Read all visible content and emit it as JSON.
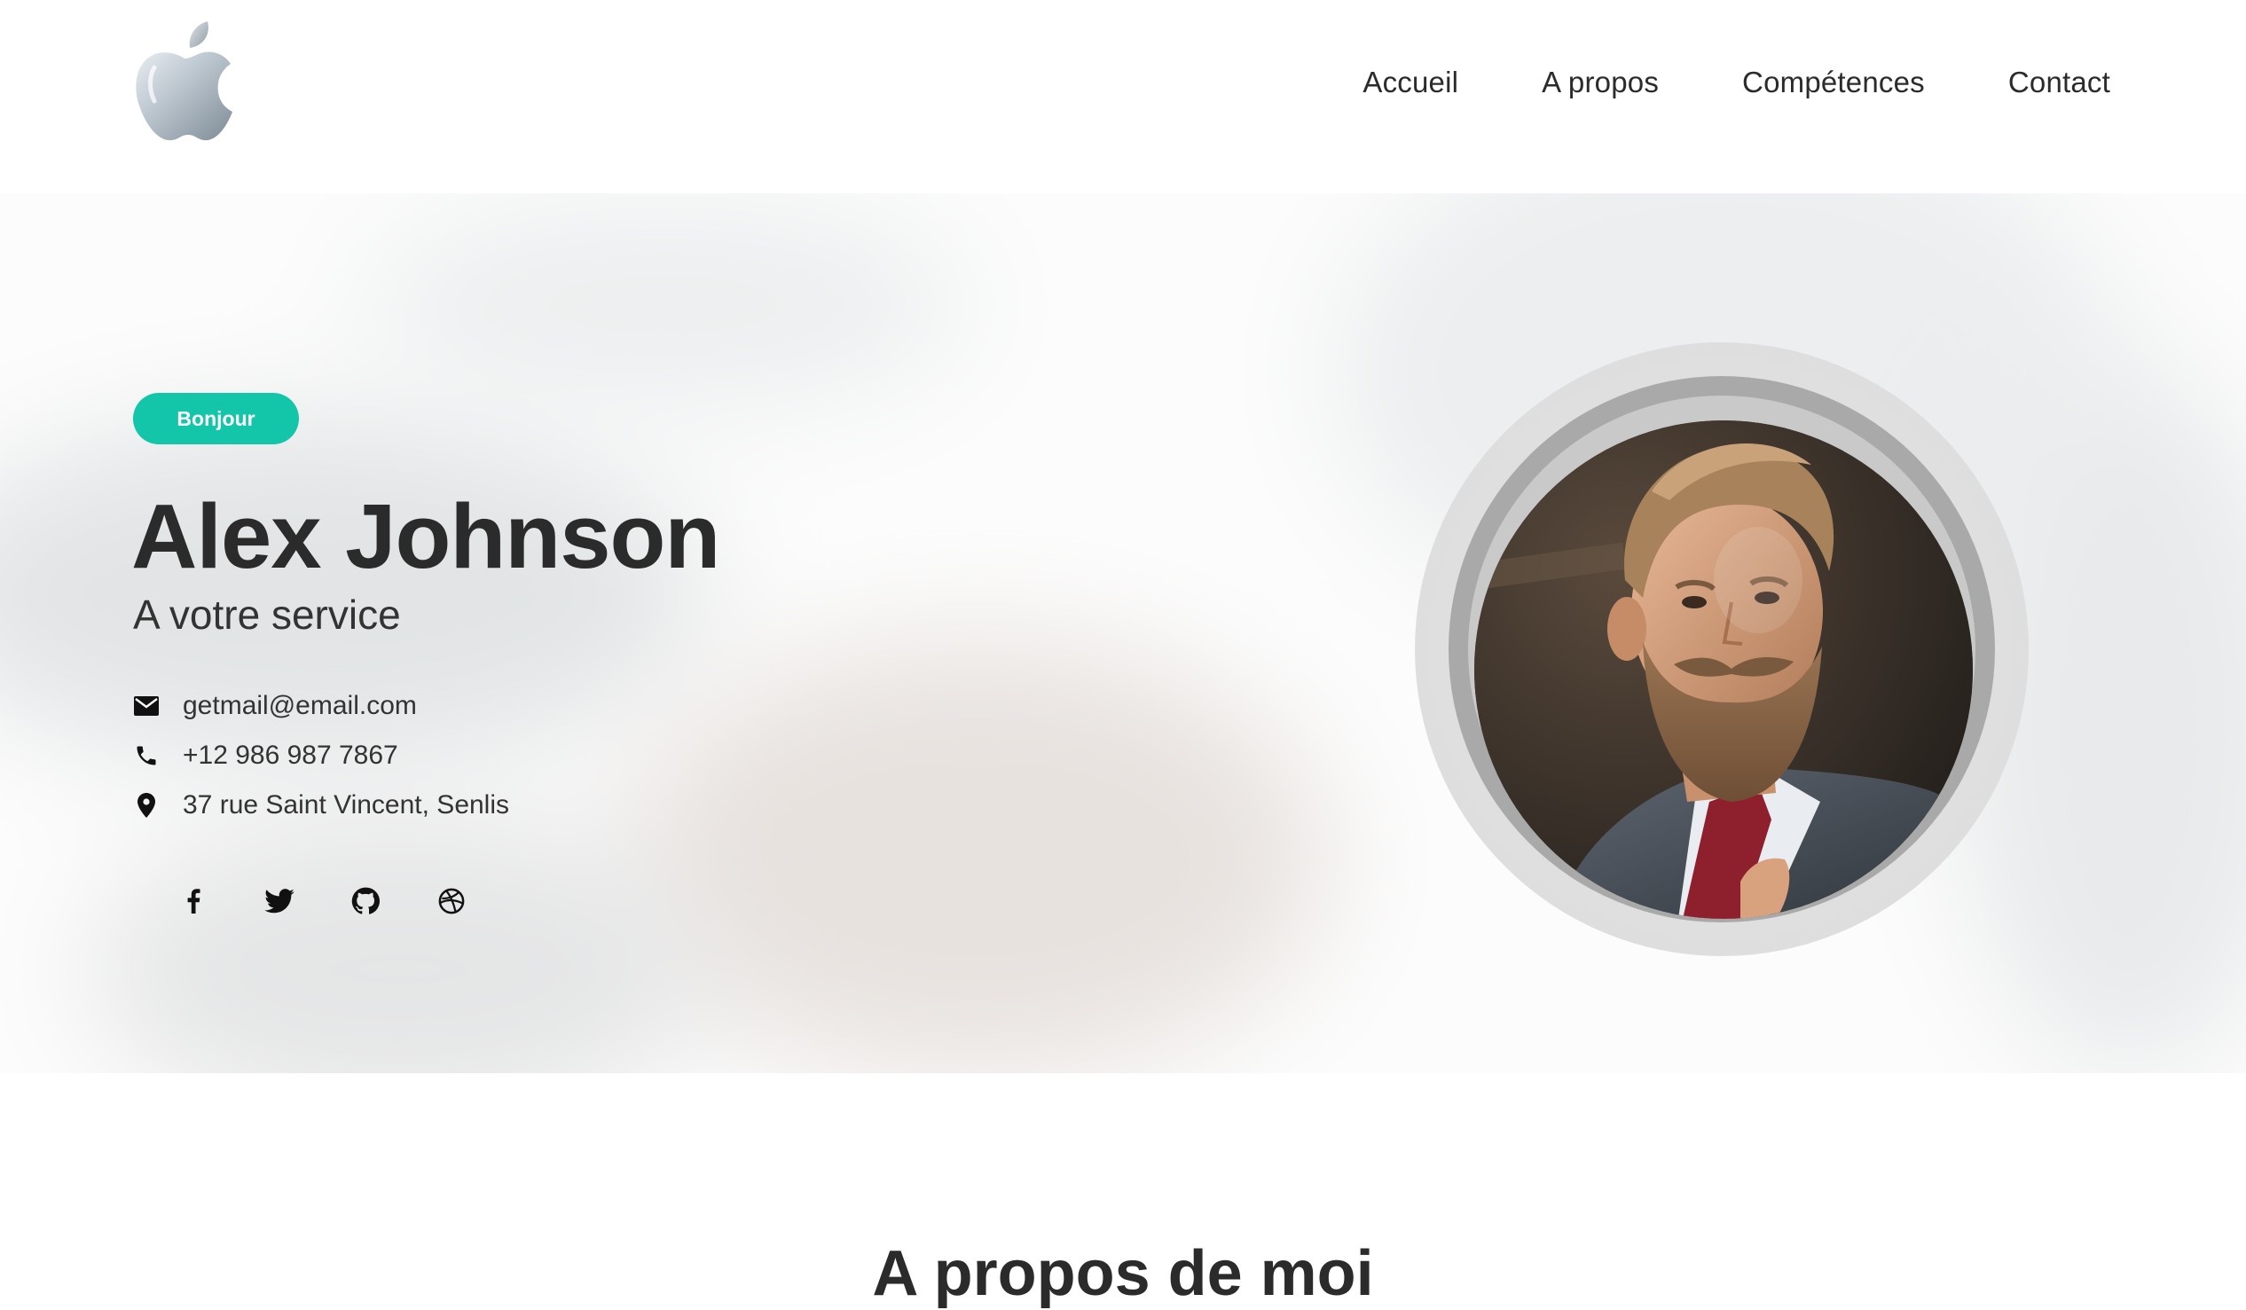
{
  "nav": {
    "items": [
      "Accueil",
      "A propos",
      "Compétences",
      "Contact"
    ]
  },
  "hero": {
    "badge": "Bonjour",
    "name": "Alex Johnson",
    "tagline": "A votre service",
    "contact": {
      "email": "getmail@email.com",
      "phone": "+12 986 987 7867",
      "address": "37 rue Saint Vincent, Senlis"
    },
    "social_icons": [
      "facebook-icon",
      "twitter-icon",
      "github-icon",
      "dribbble-icon"
    ]
  },
  "next_section": {
    "title": "A propos de moi"
  },
  "colors": {
    "accent": "#14c6a9",
    "text": "#2b2b2b"
  }
}
